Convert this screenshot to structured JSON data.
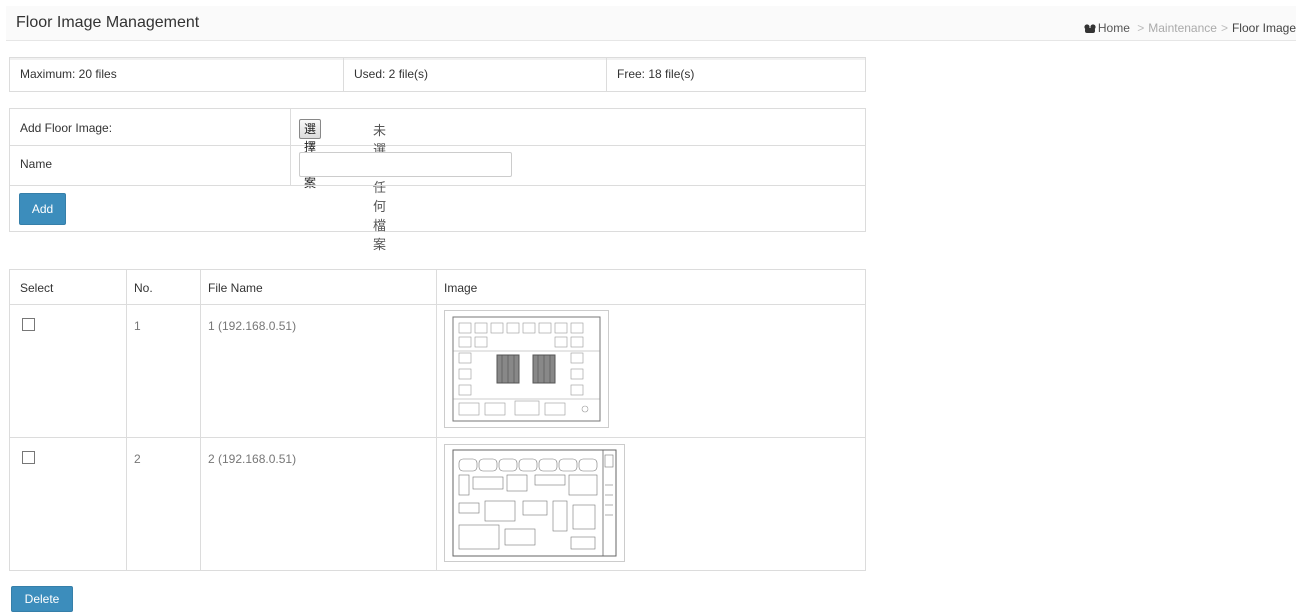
{
  "header": {
    "title": "Floor Image Management",
    "breadcrumb": [
      "Home",
      "Maintenance",
      "Floor Image"
    ]
  },
  "stats": {
    "maximum": "Maximum: 20 files",
    "used": "Used: 2 file(s)",
    "free": "Free: 18 file(s)"
  },
  "form": {
    "add_label": "Add Floor Image:",
    "file_button": "選擇檔案",
    "file_status": "未選擇任何檔案",
    "name_label": "Name",
    "name_value": "",
    "add_button": "Add"
  },
  "table": {
    "headers": [
      "Select",
      "No.",
      "File Name",
      "Image"
    ],
    "rows": [
      {
        "no": "1",
        "file_name": "1 (192.168.0.51)",
        "checked": false
      },
      {
        "no": "2",
        "file_name": "2 (192.168.0.51)",
        "checked": false
      }
    ]
  },
  "delete_button": "Delete",
  "colors": {
    "accent": "#3c8dbc",
    "border": "#dcdcdc"
  },
  "icons": {
    "home": "home-icon"
  }
}
